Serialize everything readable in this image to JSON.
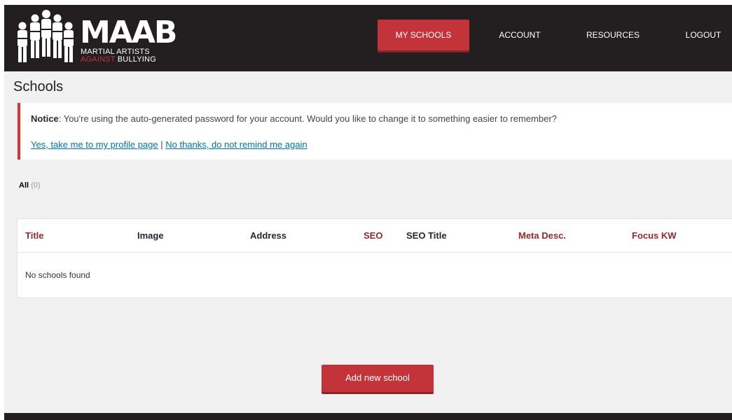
{
  "brand": {
    "name": "MAAB",
    "tagline_line1": "MARTIAL ARTISTS",
    "tagline_line2_part1": "AGAINST",
    "tagline_line2_part2": "BULLYING"
  },
  "nav": {
    "items": [
      {
        "label": "MY SCHOOLS"
      },
      {
        "label": "ACCOUNT"
      },
      {
        "label": "RESOURCES"
      },
      {
        "label": "LOGOUT"
      }
    ]
  },
  "page": {
    "title": "Schools"
  },
  "notice": {
    "heading": "Notice",
    "message": ": You're using the auto-generated password for your account. Would you like to change it to something easier to remember?",
    "link_profile": "Yes, take me to my profile page",
    "separator": " | ",
    "link_dismiss": "No thanks, do not remind me again"
  },
  "filter": {
    "label": "All",
    "count": "(0)"
  },
  "table": {
    "columns": [
      {
        "label": "Title"
      },
      {
        "label": "Image"
      },
      {
        "label": "Address"
      },
      {
        "label": "SEO"
      },
      {
        "label": "SEO Title"
      },
      {
        "label": "Meta Desc."
      },
      {
        "label": "Focus KW"
      }
    ],
    "empty_message": "No schools found"
  },
  "actions": {
    "add_label": "Add new school"
  },
  "colors": {
    "header_bg": "#231f20",
    "accent": "#c3343a",
    "notice_border": "#dc3232",
    "link": "#0073aa",
    "sortable_header": "#8f2a33"
  }
}
